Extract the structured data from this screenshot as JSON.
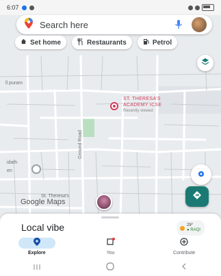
{
  "status_bar": {
    "time": "6:07"
  },
  "search": {
    "placeholder": "Search here"
  },
  "chips": [
    {
      "label": "Set home",
      "icon": "home-icon"
    },
    {
      "label": "Restaurants",
      "icon": "fork-knife-icon"
    },
    {
      "label": "Petrol",
      "icon": "fuel-icon"
    }
  ],
  "map": {
    "area_label": "ll puram",
    "area_label_2": "idath",
    "area_label_3": "en",
    "street_label": "Ground Road",
    "place_label": "St. Theresa's",
    "school_name_line1": "ST. THERESA'S",
    "school_name_line2": "ACADEMY ICSE",
    "school_sub": "Recently viewed",
    "logo_text": "Google Maps"
  },
  "sheet": {
    "title": "Local vibe",
    "weather_temp": "29°",
    "weather_aqi": "● RAQI"
  },
  "nav": [
    {
      "label": "Explore",
      "icon": "location-pin-icon",
      "active": true
    },
    {
      "label": "You",
      "icon": "bookmark-icon",
      "active": false
    },
    {
      "label": "Contribute",
      "icon": "plus-circle-icon",
      "active": false
    }
  ],
  "colors": {
    "accent": "#1a7a73",
    "place": "#d33b5a",
    "active_nav": "#cfe7f8"
  }
}
